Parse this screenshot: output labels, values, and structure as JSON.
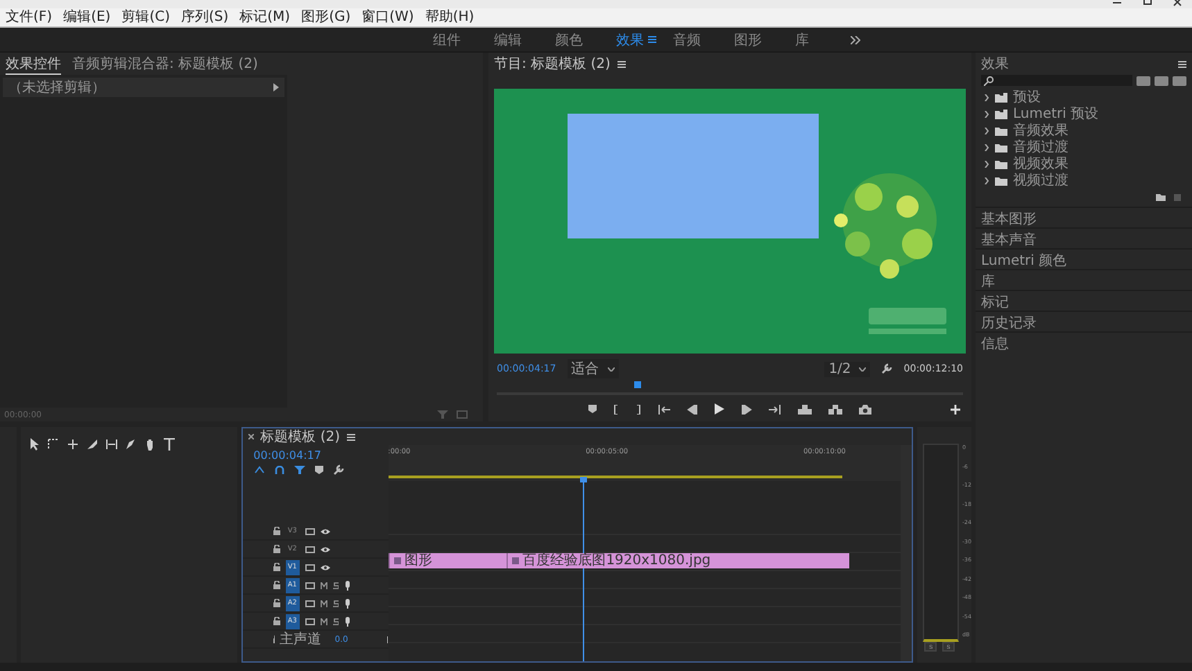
{
  "menu": [
    "文件(F)",
    "编辑(E)",
    "剪辑(C)",
    "序列(S)",
    "标记(M)",
    "图形(G)",
    "窗口(W)",
    "帮助(H)"
  ],
  "workspaces": [
    {
      "label": "组件",
      "selected": false
    },
    {
      "label": "编辑",
      "selected": false
    },
    {
      "label": "颜色",
      "selected": false
    },
    {
      "label": "效果",
      "selected": true
    },
    {
      "label": "音频",
      "selected": false
    },
    {
      "label": "图形",
      "selected": false
    },
    {
      "label": "库",
      "selected": false
    }
  ],
  "source_panel": {
    "tabs": [
      {
        "label": "效果控件",
        "selected": true
      },
      {
        "label": "音频剪辑混合器: 标题模板 (2)",
        "selected": false
      }
    ],
    "clip_row": "（未选择剪辑）",
    "timecode": "00:00:00"
  },
  "program": {
    "title": "节目: 标题模板 (2)",
    "timecode": "00:00:04:17",
    "zoom": "适合",
    "resolution": "1/2",
    "duration": "00:00:12:10"
  },
  "timeline": {
    "title": "标题模板 (2)",
    "timecode": "00:00:04:17",
    "ruler": [
      ":00:00",
      "00:00:05:00",
      "00:00:10:00"
    ],
    "tracks": [
      {
        "kind": "video",
        "name": "V3",
        "targeted": false
      },
      {
        "kind": "video",
        "name": "V2",
        "targeted": false
      },
      {
        "kind": "video",
        "name": "V1",
        "targeted": true
      },
      {
        "kind": "audio",
        "name": "A1",
        "targeted": true
      },
      {
        "kind": "audio",
        "name": "A2",
        "targeted": true
      },
      {
        "kind": "audio",
        "name": "A3",
        "targeted": true
      },
      {
        "kind": "master",
        "name": "主声道",
        "value": "0.0"
      }
    ],
    "clips": [
      {
        "label": "图形"
      },
      {
        "label": "百度经验底图1920x1080.jpg"
      }
    ]
  },
  "meter": {
    "scale": [
      "0",
      "-6",
      "-12",
      "-18",
      "-24",
      "-30",
      "-36",
      "-42",
      "-48",
      "-54",
      "dB"
    ],
    "solo": [
      "S",
      "S"
    ]
  },
  "effects": {
    "title": "效果",
    "items": [
      {
        "label": "预设",
        "kind": "preset",
        "expanded": false
      },
      {
        "label": "Lumetri 预设",
        "kind": "preset",
        "expanded": false
      },
      {
        "label": "音频效果",
        "kind": "folder",
        "expanded": false
      },
      {
        "label": "音频过渡",
        "kind": "folder",
        "expanded": false
      },
      {
        "label": "视频效果",
        "kind": "folder",
        "expanded": false
      },
      {
        "label": "视频过渡",
        "kind": "folder",
        "expanded": false
      }
    ]
  },
  "panels": [
    "基本图形",
    "基本声音",
    "Lumetri 颜色",
    "库",
    "标记",
    "历史记录",
    "信息"
  ]
}
